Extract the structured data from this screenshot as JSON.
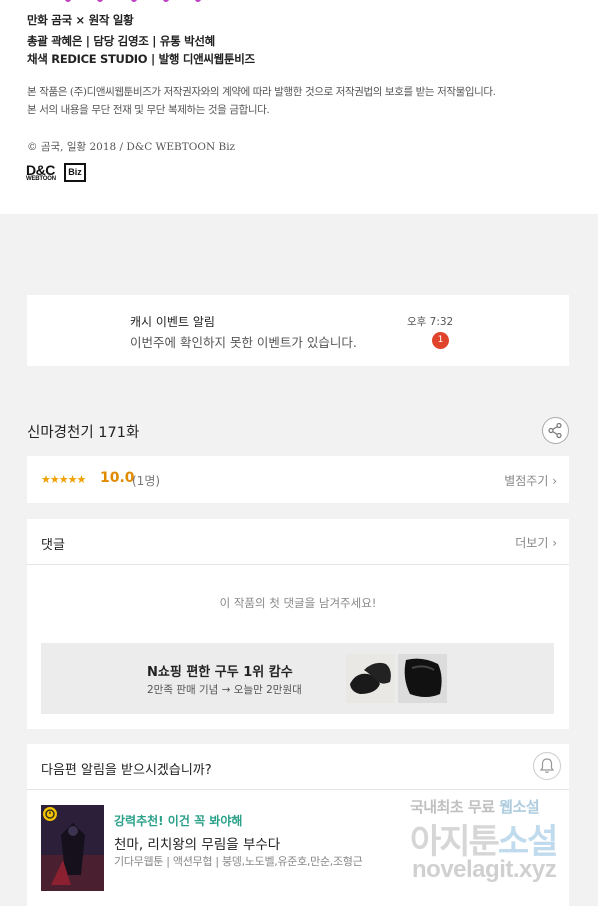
{
  "credits": {
    "line1": "만화 곰국 × 원작 일황",
    "line2": "총괄 곽혜은 | 담당 김영조 | 유통 박선혜",
    "line3": "채색 REDICE STUDIO | 발행 디앤씨웹툰비즈",
    "notice1": "본 작품은 (주)디앤씨웹툰비즈가 저작권자와의 계약에 따라 발행한 것으로 저작권법의 보호를 받는 저작물입니다.",
    "notice2": "본 서의 내용을 무단 전재 및 무단 복제하는 것을 금합니다.",
    "copyright": "© 곰국, 일황 2018 / D&C WEBTOON Biz",
    "logo_main": "D&C",
    "logo_sub": "WEBTOON",
    "logo_box": "Biz"
  },
  "notification": {
    "title": "캐시 이벤트 알림",
    "message": "이번주에 확인하지 못한 이벤트가 있습니다.",
    "time": "오후 7:32",
    "count": "1"
  },
  "episode": {
    "title": "신마경천기 171화"
  },
  "rating": {
    "stars": "★★★★★",
    "score": "10.0",
    "count": "(1명)",
    "rate_button": "별점주기 ›"
  },
  "comments": {
    "header": "댓글",
    "more": "더보기 ›",
    "empty": "이 작품의 첫 댓글을 남겨주세요!"
  },
  "ad": {
    "title": "N쇼핑 편한 구두 1위 캄수",
    "subtitle": "2만족 판매 기념 → 오늘만 2만원대"
  },
  "next_episode": {
    "question": "다음편 알림을 받으시겠습니까?",
    "recommend": "강력추천! 이건 꼭 봐야해",
    "work_title": "천마, 리치왕의 무림을 부수다",
    "meta": "기다무웹툰 | 액션무협 | 붕뎅,노도벨,유준호,만순,조형근"
  },
  "watermark": {
    "line1_a": "국내최초 무료",
    "line1_b": "웹소설",
    "line2_a": "아지툰",
    "line2_b": "소설",
    "line3": "novelagit.xyz"
  },
  "colors": {
    "accent_green": "#2aa08a",
    "star_orange": "#f0a000",
    "badge_red": "#e0452b"
  }
}
